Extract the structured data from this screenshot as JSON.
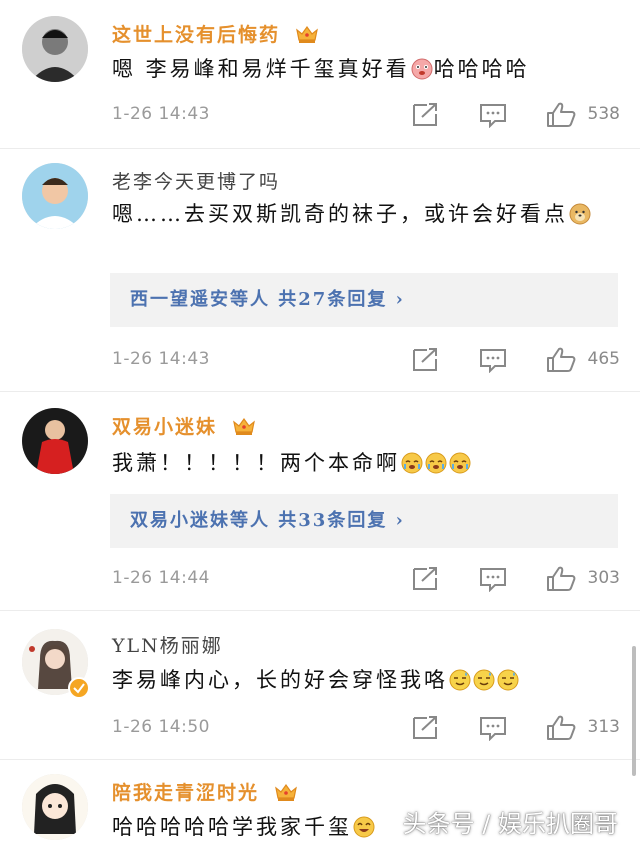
{
  "comments": [
    {
      "username": "这世上没有后悔药",
      "vip": true,
      "text": "嗯 李易峰和易烊千玺真好看",
      "text_suffix": "哈哈哈哈",
      "time": "1-26 14:43",
      "likes": "538"
    },
    {
      "username": "老李今天更博了吗",
      "vip": false,
      "text": "嗯……去买双斯凯奇的袜子，或许会好看点",
      "replies": "西一望遥安等人 共27条回复 ›",
      "time": "1-26 14:43",
      "likes": "465"
    },
    {
      "username": "双易小迷妹",
      "vip": true,
      "text": "我萧！！！！！两个本命啊",
      "replies": "双易小迷妹等人 共33条回复 ›",
      "time": "1-26 14:44",
      "likes": "303"
    },
    {
      "username": "YLN杨丽娜",
      "vip": false,
      "text": "李易峰内心，长的好会穿怪我咯",
      "time": "1-26 14:50",
      "likes": "313"
    },
    {
      "username": "陪我走青涩时光",
      "vip": true,
      "text": "哈哈哈哈哈学我家千玺"
    }
  ],
  "watermark": "头条号 / 娱乐扒圈哥",
  "icons": {
    "crown": "crown-icon",
    "share": "share-icon",
    "comment": "comment-icon",
    "like": "thumbs-up-icon"
  },
  "colors": {
    "vip_name": "#e5902d",
    "reply_link": "#4c72b0",
    "meta": "#9a9a9a"
  }
}
